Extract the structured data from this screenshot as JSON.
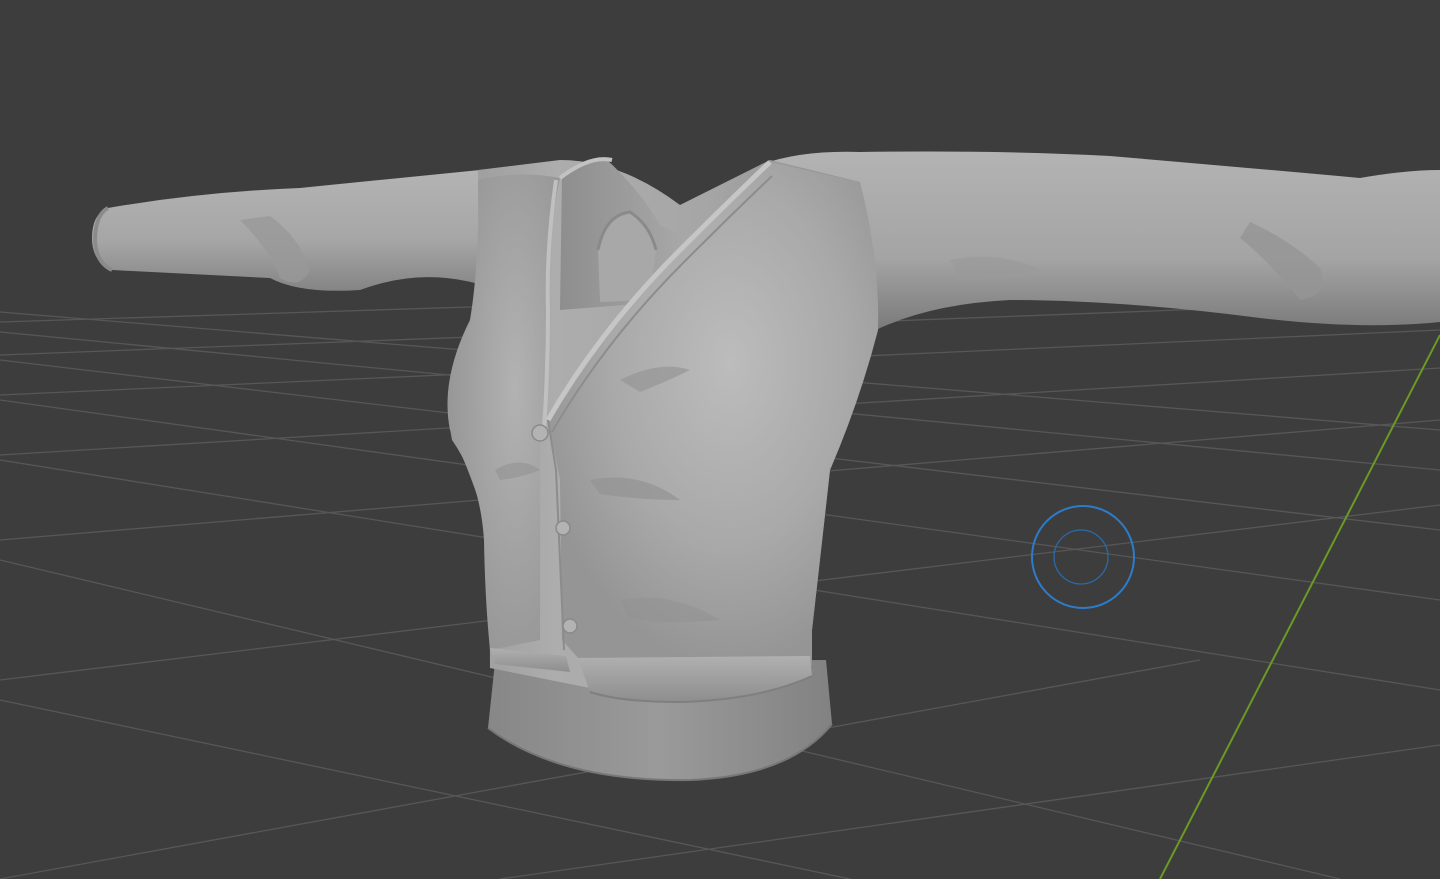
{
  "viewport": {
    "background_color": "#3d3d3d",
    "grid_color": "#575757",
    "y_axis_color": "#6a9a23",
    "model_color": "#a3a3a3",
    "brush_cursor_color": "#2d7cc9"
  },
  "scene": {
    "object": "sculpted-cardigan-mesh",
    "visible_buttons": 3,
    "active_tool": "sculpt-brush-cursor"
  }
}
